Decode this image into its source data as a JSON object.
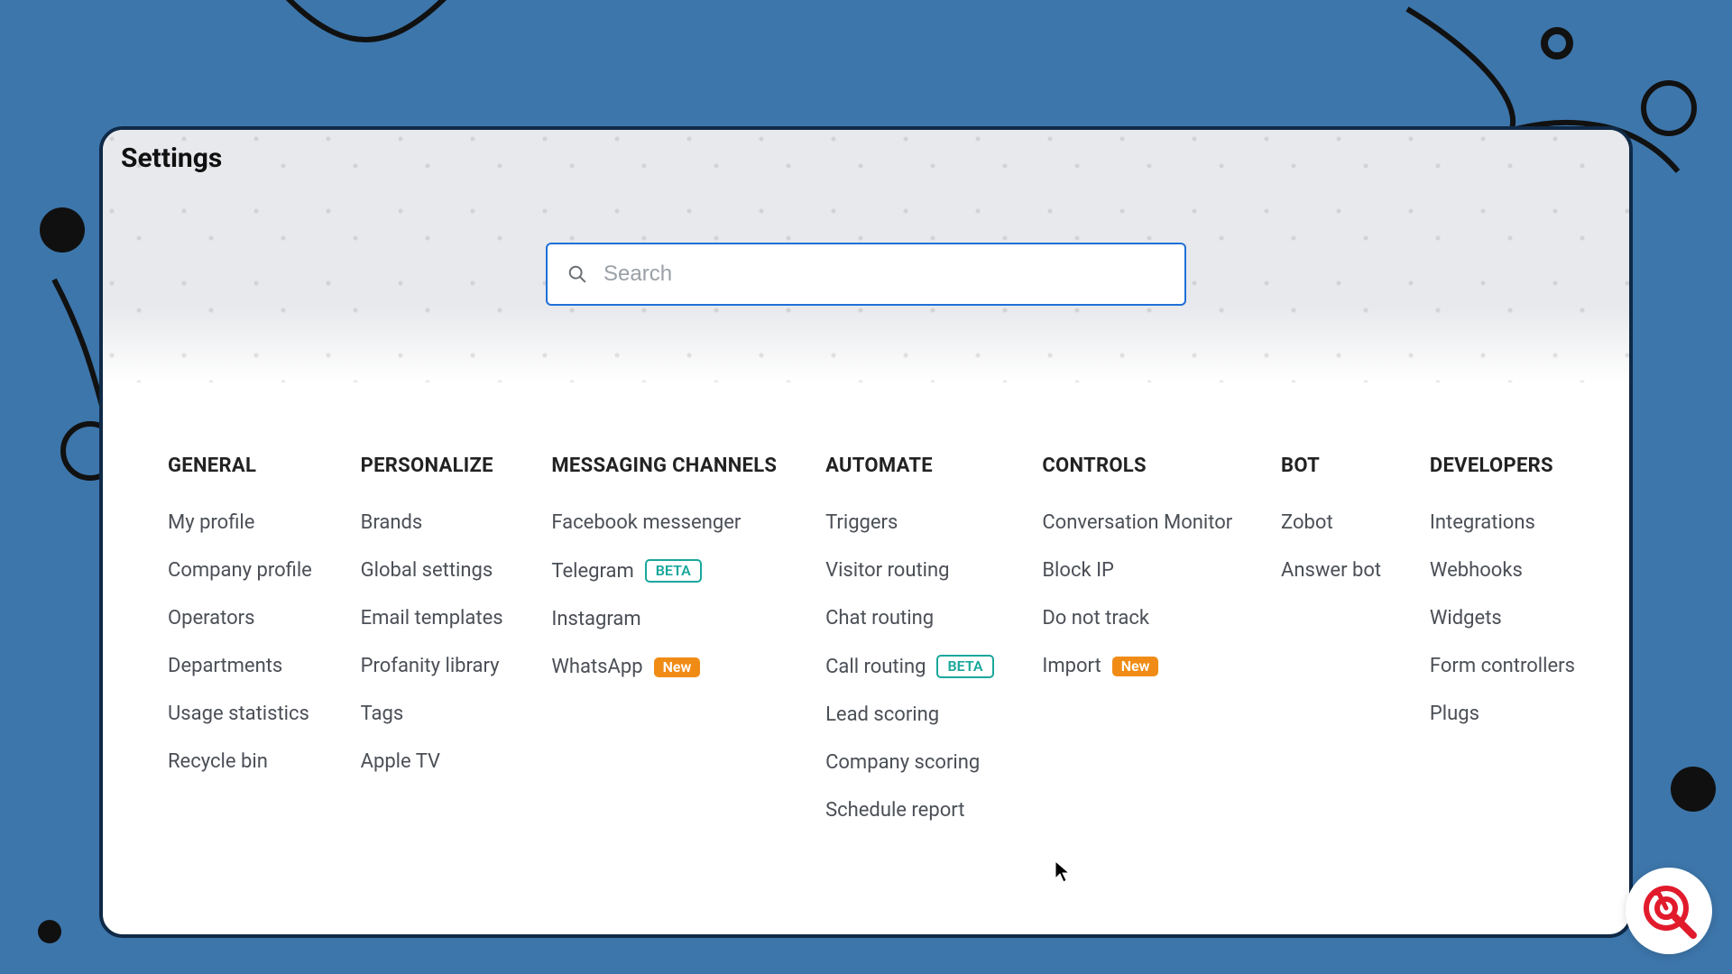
{
  "page_title": "Settings",
  "search": {
    "placeholder": "Search"
  },
  "badges": {
    "beta": "BETA",
    "new": "New"
  },
  "columns": [
    {
      "id": "general",
      "heading": "GENERAL",
      "items": [
        {
          "label": "My profile"
        },
        {
          "label": "Company profile"
        },
        {
          "label": "Operators"
        },
        {
          "label": "Departments"
        },
        {
          "label": "Usage statistics"
        },
        {
          "label": "Recycle bin"
        }
      ]
    },
    {
      "id": "personalize",
      "heading": "PERSONALIZE",
      "items": [
        {
          "label": "Brands"
        },
        {
          "label": "Global settings"
        },
        {
          "label": "Email templates"
        },
        {
          "label": "Profanity library"
        },
        {
          "label": "Tags"
        },
        {
          "label": "Apple TV"
        }
      ]
    },
    {
      "id": "messaging",
      "heading": "MESSAGING CHANNELS",
      "items": [
        {
          "label": "Facebook messenger"
        },
        {
          "label": "Telegram",
          "badge": "beta"
        },
        {
          "label": "Instagram"
        },
        {
          "label": "WhatsApp",
          "badge": "new"
        }
      ]
    },
    {
      "id": "automate",
      "heading": "AUTOMATE",
      "items": [
        {
          "label": "Triggers"
        },
        {
          "label": "Visitor routing"
        },
        {
          "label": "Chat routing"
        },
        {
          "label": "Call routing",
          "badge": "beta"
        },
        {
          "label": "Lead scoring"
        },
        {
          "label": "Company scoring"
        },
        {
          "label": "Schedule report"
        }
      ]
    },
    {
      "id": "controls",
      "heading": "CONTROLS",
      "items": [
        {
          "label": "Conversation Monitor"
        },
        {
          "label": "Block IP"
        },
        {
          "label": "Do not track"
        },
        {
          "label": "Import",
          "badge": "new"
        }
      ]
    },
    {
      "id": "bot",
      "heading": "BOT",
      "items": [
        {
          "label": "Zobot"
        },
        {
          "label": "Answer bot"
        }
      ]
    },
    {
      "id": "developers",
      "heading": "DEVELOPERS",
      "items": [
        {
          "label": "Integrations"
        },
        {
          "label": "Webhooks"
        },
        {
          "label": "Widgets"
        },
        {
          "label": "Form controllers"
        },
        {
          "label": "Plugs"
        }
      ]
    }
  ]
}
